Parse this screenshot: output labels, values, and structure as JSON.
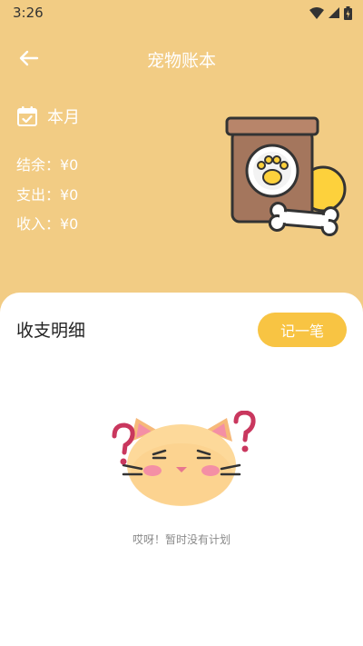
{
  "status_bar": {
    "time": "3:26"
  },
  "header": {
    "title": "宠物账本"
  },
  "summary": {
    "period_label": "本月",
    "balance": "结余：¥0",
    "expense": "支出：¥0",
    "income": "收入：¥0"
  },
  "details": {
    "title": "收支明细",
    "record_button": "记一笔",
    "empty_message": "哎呀！暂时没有计划"
  },
  "colors": {
    "background": "#F2CC84",
    "accent_button": "#F8C443",
    "panel": "#FFFFFF"
  },
  "icons": [
    "wifi-icon",
    "signal-icon",
    "battery-icon",
    "back-arrow-icon",
    "calendar-icon"
  ]
}
